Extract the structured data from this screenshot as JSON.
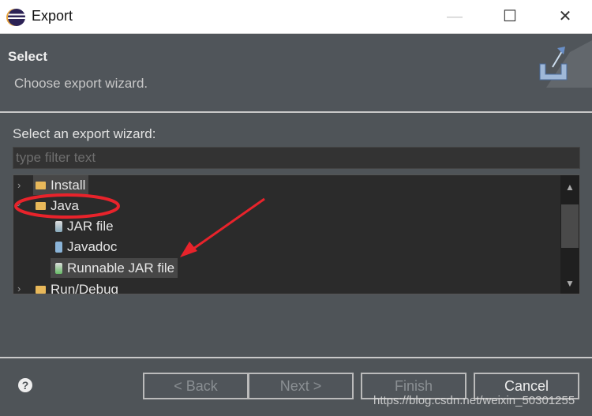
{
  "window": {
    "title": "Export",
    "minimize": "—",
    "maximize": "☐",
    "close": "✕"
  },
  "header": {
    "title": "Select",
    "description": "Choose export wizard."
  },
  "body": {
    "label": "Select an export wizard:",
    "filter_placeholder": "type filter text",
    "filter_value": ""
  },
  "tree": {
    "items": [
      {
        "label": "Install",
        "type": "folder",
        "expanded": false
      },
      {
        "label": "Java",
        "type": "folder",
        "expanded": true
      },
      {
        "label": "JAR file",
        "type": "jar"
      },
      {
        "label": "Javadoc",
        "type": "javadoc"
      },
      {
        "label": "Runnable JAR file",
        "type": "jar",
        "selected": true
      },
      {
        "label": "Run/Debug",
        "type": "folder",
        "expanded": false
      }
    ]
  },
  "buttons": {
    "help": "?",
    "back": "< Back",
    "next": "Next >",
    "finish": "Finish",
    "cancel": "Cancel"
  },
  "watermark": "https://blog.csdn.net/weixin_50301255",
  "colors": {
    "annotation": "#e8232b",
    "background": "#4f5458",
    "tree_bg": "#2b2b2b"
  }
}
